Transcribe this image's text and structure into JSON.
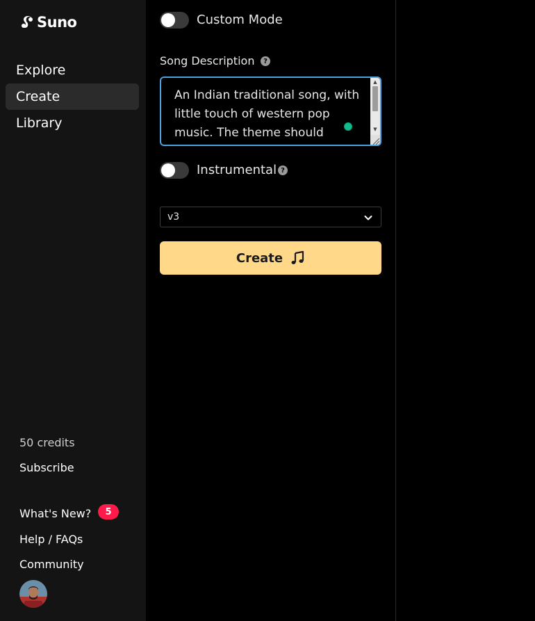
{
  "brand": {
    "name": "Suno",
    "logo_icon": "suno-logo-icon"
  },
  "nav": {
    "items": [
      {
        "label": "Explore",
        "active": false
      },
      {
        "label": "Create",
        "active": true
      },
      {
        "label": "Library",
        "active": false
      }
    ]
  },
  "sidebar_footer": {
    "credits": "50 credits",
    "subscribe": "Subscribe",
    "whats_new": "What's New?",
    "whats_new_badge": "5",
    "help": "Help / FAQs",
    "community": "Community"
  },
  "form": {
    "custom_mode": {
      "label": "Custom Mode",
      "on": false
    },
    "song_description": {
      "label": "Song Description",
      "value": "An Indian traditional song, with little touch of western pop music. The theme should"
    },
    "instrumental": {
      "label": "Instrumental",
      "on": false
    },
    "model_select": {
      "value": "v3"
    },
    "create_button": {
      "label": "Create",
      "icon": "music-note-icon"
    }
  },
  "colors": {
    "accent_button": "#ffd88a",
    "focus_border": "#4aa3e0",
    "badge": "#ff1a4b"
  }
}
